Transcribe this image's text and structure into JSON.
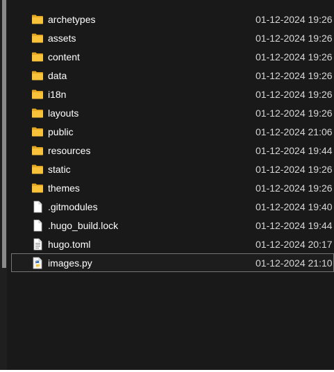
{
  "files": [
    {
      "name": "archetypes",
      "modified": "01-12-2024 19:26",
      "icon": "folder-icon"
    },
    {
      "name": "assets",
      "modified": "01-12-2024 19:26",
      "icon": "folder-icon"
    },
    {
      "name": "content",
      "modified": "01-12-2024 19:26",
      "icon": "folder-icon"
    },
    {
      "name": "data",
      "modified": "01-12-2024 19:26",
      "icon": "folder-icon"
    },
    {
      "name": "i18n",
      "modified": "01-12-2024 19:26",
      "icon": "folder-icon"
    },
    {
      "name": "layouts",
      "modified": "01-12-2024 19:26",
      "icon": "folder-icon"
    },
    {
      "name": "public",
      "modified": "01-12-2024 21:06",
      "icon": "folder-icon"
    },
    {
      "name": "resources",
      "modified": "01-12-2024 19:44",
      "icon": "folder-icon"
    },
    {
      "name": "static",
      "modified": "01-12-2024 19:26",
      "icon": "folder-icon"
    },
    {
      "name": "themes",
      "modified": "01-12-2024 19:26",
      "icon": "folder-icon"
    },
    {
      "name": ".gitmodules",
      "modified": "01-12-2024 19:40",
      "icon": "blank-file-icon"
    },
    {
      "name": ".hugo_build.lock",
      "modified": "01-12-2024 19:44",
      "icon": "blank-file-icon"
    },
    {
      "name": "hugo.toml",
      "modified": "01-12-2024 20:17",
      "icon": "text-file-icon"
    },
    {
      "name": "images.py",
      "modified": "01-12-2024 21:10",
      "icon": "python-file-icon",
      "selected": true
    }
  ],
  "colors": {
    "background": "#191919",
    "folder": "#f8c33a",
    "text": "#ffffff",
    "date_text": "#d8d8d8",
    "selection_border": "#767676"
  }
}
